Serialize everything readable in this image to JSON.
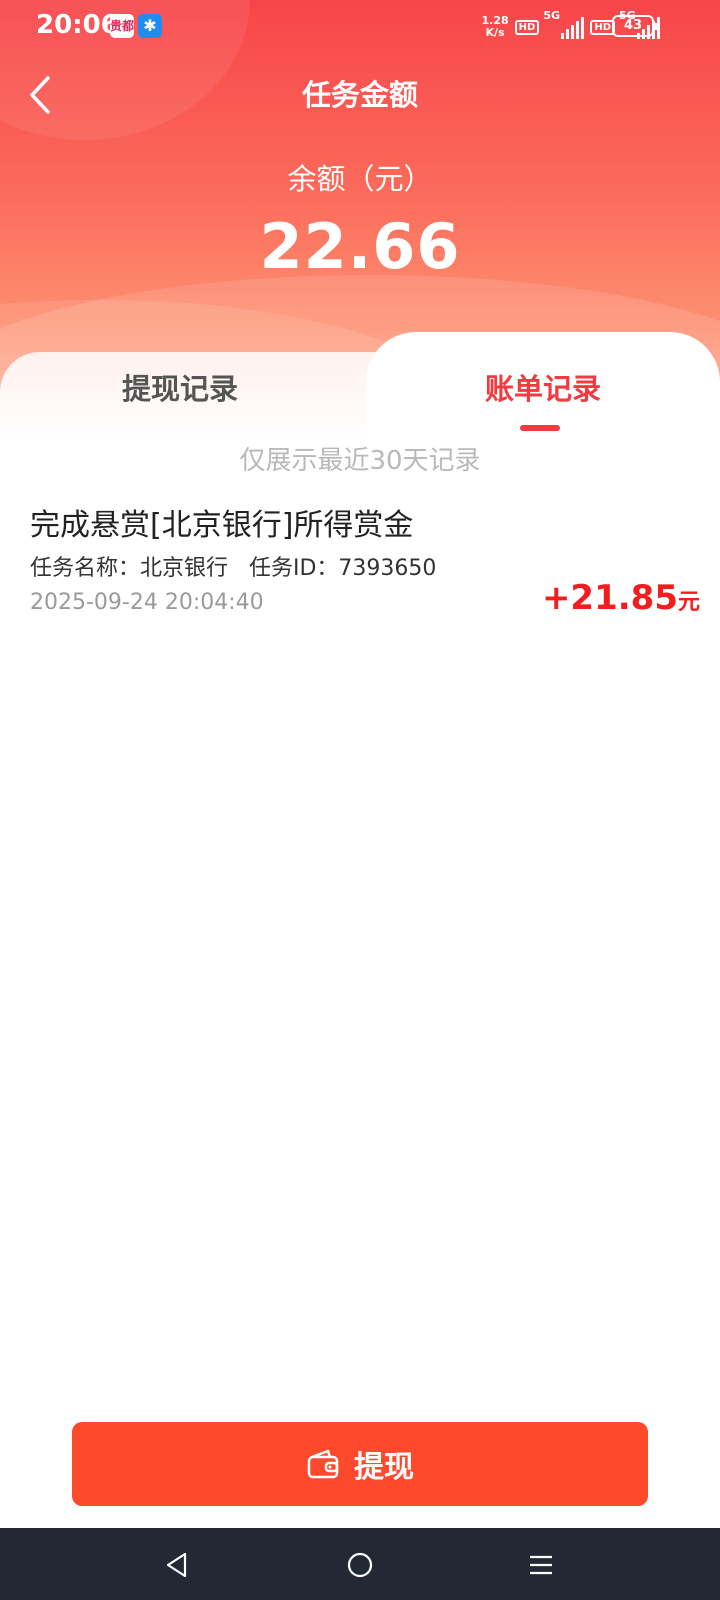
{
  "status_bar": {
    "time": "20:06",
    "app_icon_1": "贵都",
    "app_icon_2": "puzzle-icon",
    "net_speed_value": "1.28",
    "net_speed_unit": "K/s",
    "hd_label": "HD",
    "network_label": "5G",
    "battery": "43"
  },
  "header": {
    "title": "任务金额",
    "balance_label": "余额（元）",
    "balance_value": "22.66"
  },
  "tabs": [
    {
      "label": "提现记录",
      "active": false
    },
    {
      "label": "账单记录",
      "active": true
    }
  ],
  "notice": "仅展示最近30天记录",
  "records": [
    {
      "title": "完成悬赏[北京银行]所得赏金",
      "meta": "任务名称：北京银行   任务ID：7393650",
      "time": "2025-09-24 20:04:40",
      "amount": "+21.85",
      "unit": "元"
    }
  ],
  "withdraw_button": {
    "label": "提现",
    "icon": "wallet-icon"
  },
  "colors": {
    "accent": "#f23a3f",
    "button": "#fd4a2c",
    "amount": "#f31d1d",
    "navbar": "#222834"
  }
}
